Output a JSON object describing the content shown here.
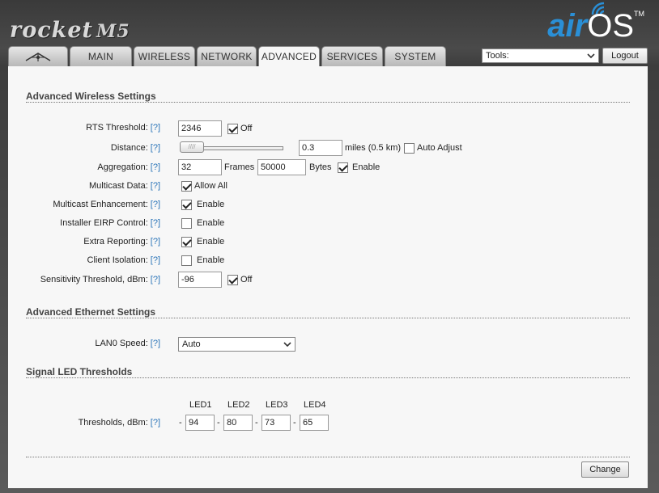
{
  "header": {
    "product_logo": "rocket",
    "product_model": "M5",
    "os_logo_air": "air",
    "os_logo_os": "OS",
    "os_logo_tm": "TM"
  },
  "tabs": [
    {
      "label": "",
      "icon": "ubiquiti-logo-icon"
    },
    {
      "label": "MAIN"
    },
    {
      "label": "WIRELESS"
    },
    {
      "label": "NETWORK"
    },
    {
      "label": "ADVANCED",
      "active": true
    },
    {
      "label": "SERVICES"
    },
    {
      "label": "SYSTEM"
    }
  ],
  "tools": {
    "selected": "Tools:"
  },
  "logout_label": "Logout",
  "help": "[?]",
  "wireless": {
    "title": "Advanced Wireless Settings",
    "rts_label": "RTS Threshold:",
    "rts_value": "2346",
    "rts_off_label": "Off",
    "distance_label": "Distance:",
    "distance_value": "0.3",
    "distance_unit": "miles (0.5 km)",
    "auto_adjust_label": "Auto Adjust",
    "aggregation_label": "Aggregation:",
    "aggregation_frames": "32",
    "frames_label": "Frames",
    "aggregation_bytes": "50000",
    "bytes_label": "Bytes",
    "aggregation_enable_label": "Enable",
    "multicast_label": "Multicast Data:",
    "multicast_allow_label": "Allow All",
    "multicast_enh_label": "Multicast Enhancement:",
    "multicast_enh_enable": "Enable",
    "eirp_label": "Installer EIRP Control:",
    "eirp_enable": "Enable",
    "extra_reporting_label": "Extra Reporting:",
    "extra_reporting_enable": "Enable",
    "client_isolation_label": "Client Isolation:",
    "client_isolation_enable": "Enable",
    "sensitivity_label": "Sensitivity Threshold, dBm:",
    "sensitivity_value": "-96",
    "sensitivity_off_label": "Off"
  },
  "ethernet": {
    "title": "Advanced Ethernet Settings",
    "lan0_label": "LAN0 Speed:",
    "lan0_value": "Auto"
  },
  "led": {
    "title": "Signal LED Thresholds",
    "headers": [
      "LED1",
      "LED2",
      "LED3",
      "LED4"
    ],
    "thresholds_label": "Thresholds, dBm:",
    "dash": "-",
    "values": [
      "94",
      "80",
      "73",
      "65"
    ]
  },
  "change_label": "Change"
}
